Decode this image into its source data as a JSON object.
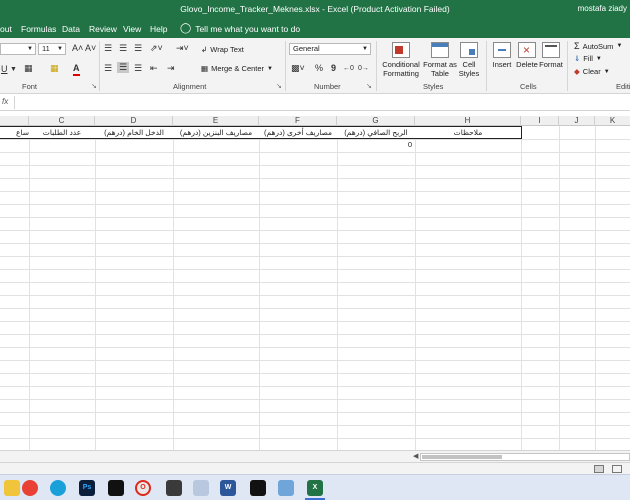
{
  "window": {
    "title": "Glovo_Income_Tracker_Meknes.xlsx  -  Excel (Product Activation Failed)",
    "user": "mostafa ziady"
  },
  "tabs": [
    {
      "label": "out"
    },
    {
      "label": "Formulas"
    },
    {
      "label": "Data"
    },
    {
      "label": "Review"
    },
    {
      "label": "View"
    },
    {
      "label": "Help"
    }
  ],
  "tell_me": "Tell me what you want to do",
  "ribbon": {
    "font": {
      "group_label": "Font",
      "size_value": "11"
    },
    "alignment": {
      "group_label": "Alignment",
      "wrap_text": "Wrap Text",
      "merge_center": "Merge & Center"
    },
    "number": {
      "group_label": "Number",
      "format_value": "General",
      "percent": "%",
      "comma": "9"
    },
    "styles": {
      "group_label": "Styles",
      "conditional": "Conditional Formatting",
      "format_table": "Format as Table",
      "cell_styles": "Cell Styles"
    },
    "cells": {
      "group_label": "Cells",
      "insert": "Insert",
      "delete": "Delete",
      "format": "Format"
    },
    "editing": {
      "group_label": "Editi",
      "autosum": "AutoSum",
      "fill": "Fill",
      "clear": "Clear"
    }
  },
  "formula_bar": {
    "fx": "fx"
  },
  "columns": [
    {
      "letter": "",
      "header": "ساع"
    },
    {
      "letter": "C",
      "header": "عدد الطلبات"
    },
    {
      "letter": "D",
      "header": "الدخل الخام (درهم)"
    },
    {
      "letter": "E",
      "header": "مصاريف البنزين (درهم)"
    },
    {
      "letter": "F",
      "header": "مصاريف أخرى (درهم)"
    },
    {
      "letter": "G",
      "header": "الربح الصافي (درهم)"
    },
    {
      "letter": "H",
      "header": "ملاحظات"
    },
    {
      "letter": "I",
      "header": ""
    },
    {
      "letter": "J",
      "header": ""
    },
    {
      "letter": "K",
      "header": ""
    }
  ],
  "cells": {
    "g2": "0"
  },
  "taskbar": {
    "icons": [
      {
        "name": "file-explorer-icon",
        "label": ""
      },
      {
        "name": "chrome-icon",
        "label": ""
      },
      {
        "name": "edge-icon",
        "label": ""
      },
      {
        "name": "photoshop-icon",
        "label": "Ps"
      },
      {
        "name": "capcut-icon",
        "label": ""
      },
      {
        "name": "app-icon",
        "label": ""
      },
      {
        "name": "opera-icon",
        "label": "O"
      },
      {
        "name": "audio-icon",
        "label": ""
      },
      {
        "name": "image-icon",
        "label": ""
      },
      {
        "name": "word-icon",
        "label": "W"
      },
      {
        "name": "capcut2-icon",
        "label": ""
      },
      {
        "name": "app2-icon",
        "label": ""
      },
      {
        "name": "excel-icon",
        "label": "X"
      }
    ]
  },
  "colors": {
    "excel_green": "#217346",
    "ribbon_bg": "#f3f3f3"
  }
}
